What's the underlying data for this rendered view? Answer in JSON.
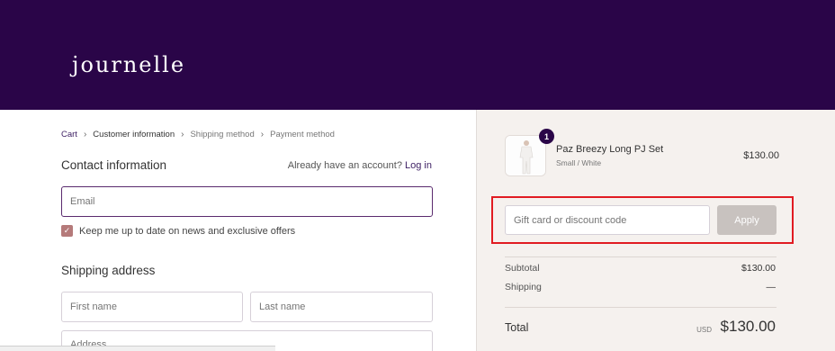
{
  "brand": {
    "logo_text": "journelle"
  },
  "breadcrumb": {
    "items": [
      "Cart",
      "Customer information",
      "Shipping method",
      "Payment method"
    ]
  },
  "contact": {
    "title": "Contact information",
    "account_prompt": "Already have an account?",
    "login_link": "Log in",
    "email_placeholder": "Email",
    "newsletter_label": "Keep me up to date on news and exclusive offers",
    "newsletter_checked": true
  },
  "shipping": {
    "title": "Shipping address",
    "first_name_placeholder": "First name",
    "last_name_placeholder": "Last name",
    "address_placeholder": "Address"
  },
  "order": {
    "item": {
      "quantity": "1",
      "name": "Paz Breezy Long PJ Set",
      "variant": "Small / White",
      "price": "$130.00"
    },
    "discount_placeholder": "Gift card or discount code",
    "apply_label": "Apply",
    "subtotal_label": "Subtotal",
    "subtotal_value": "$130.00",
    "shipping_label": "Shipping",
    "shipping_value": "—",
    "total_label": "Total",
    "total_currency": "USD",
    "total_value": "$130.00"
  },
  "colors": {
    "header_bg": "#2a0548",
    "accent": "#3d1f63",
    "highlight": "#e11b22",
    "checkbox": "#b57a7a",
    "sidebar_bg": "#f5f1ee"
  }
}
